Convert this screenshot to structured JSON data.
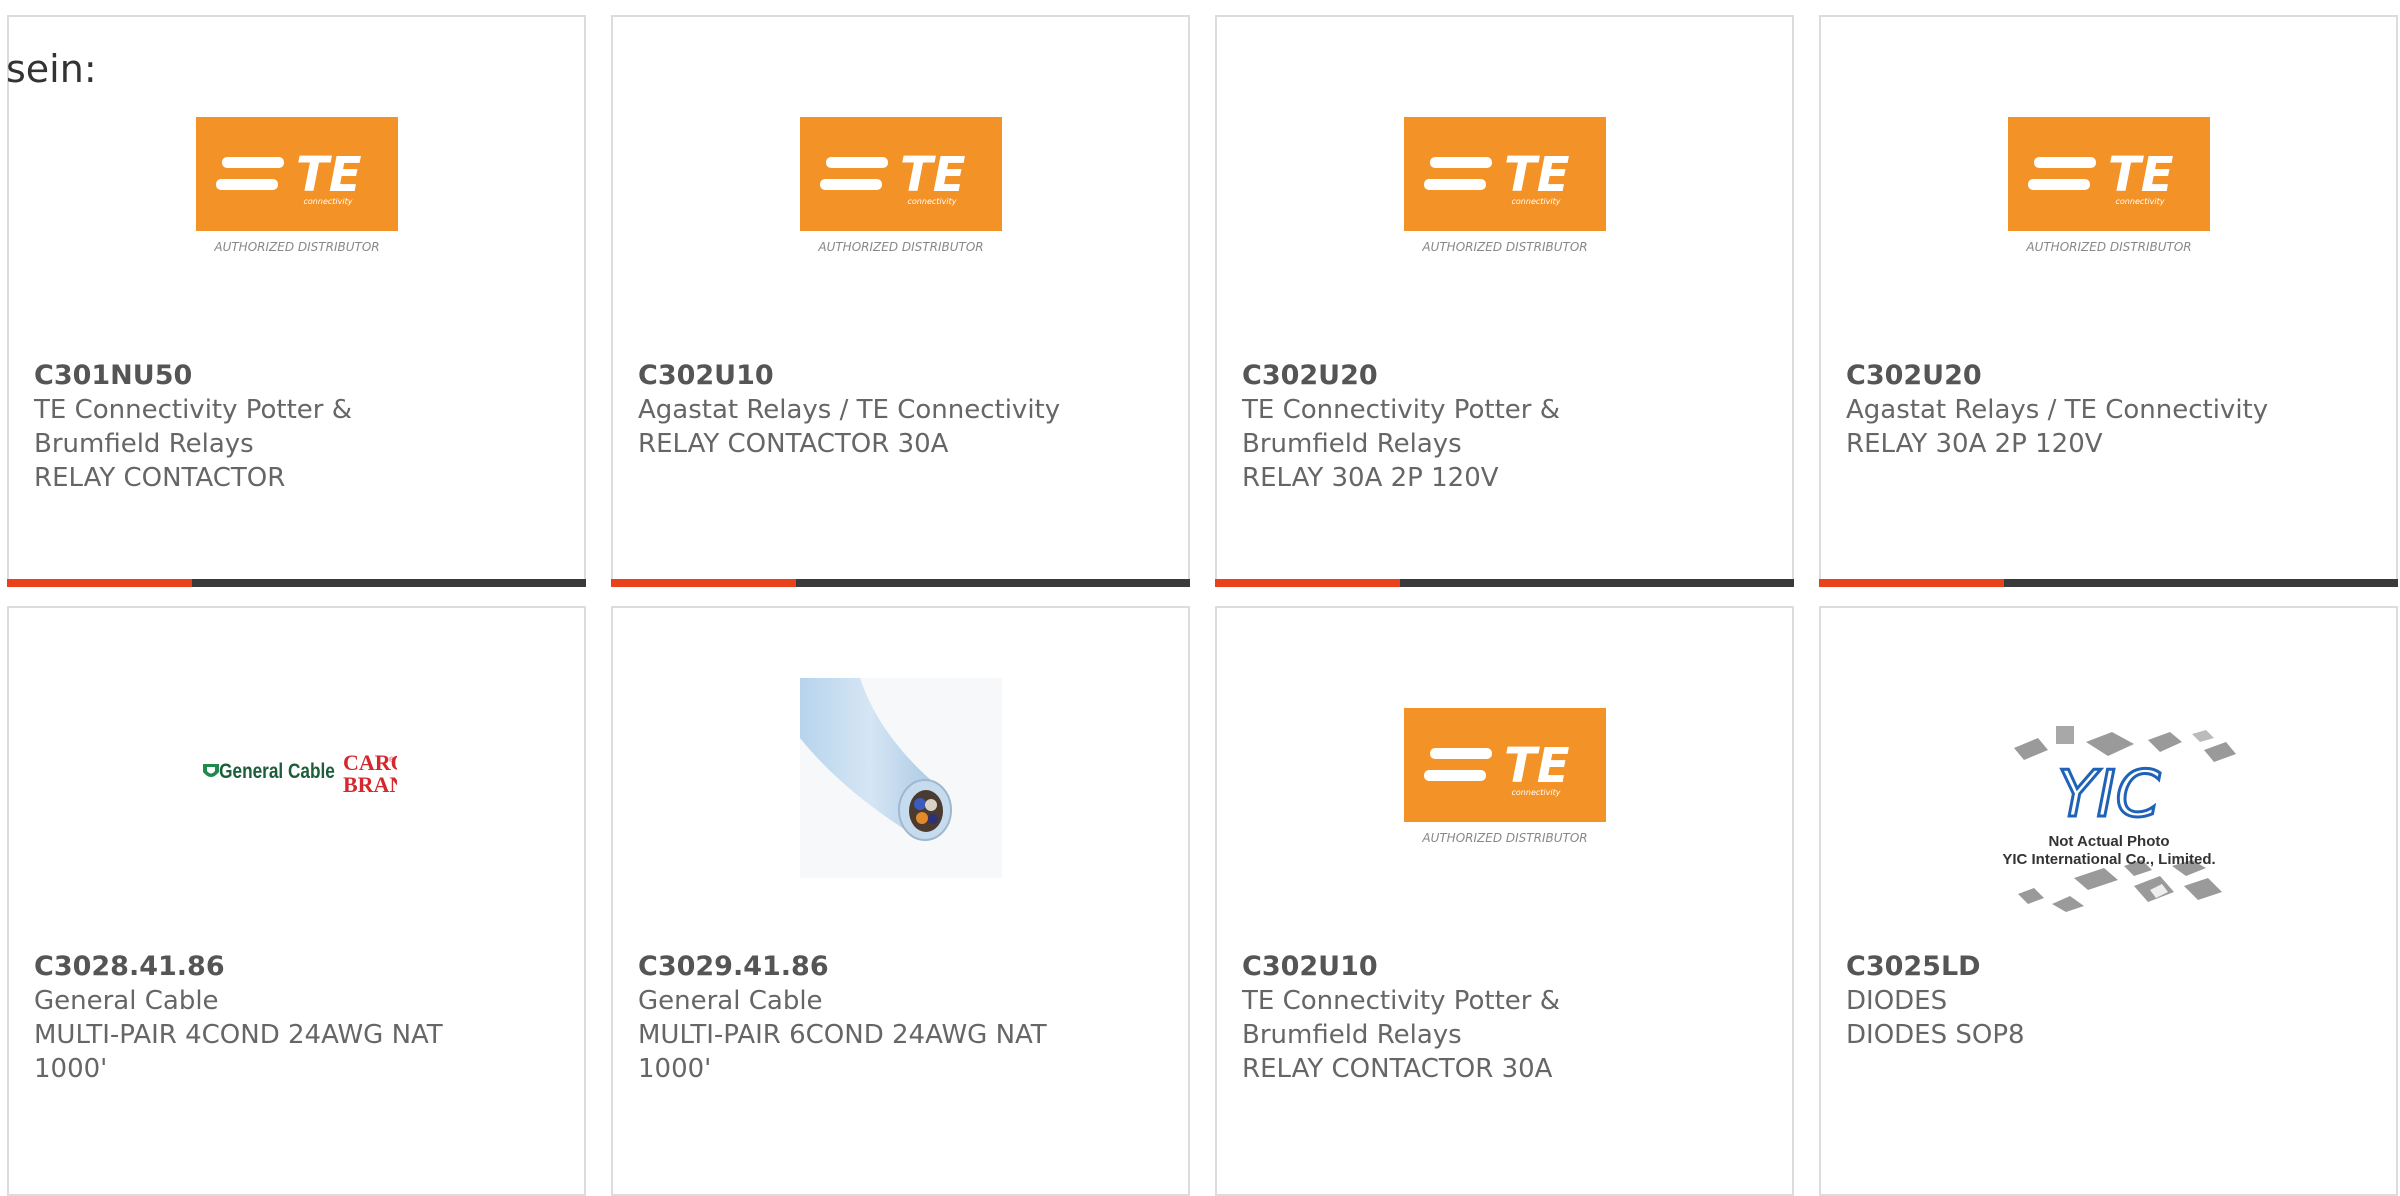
{
  "intro": "sein:",
  "colors": {
    "accent": "#e8411c",
    "bar_track": "#3a3a3a",
    "te_orange": "#f39226"
  },
  "te_logo": {
    "wordmark": "TE",
    "tagline": "connectivity",
    "caption": "AUTHORIZED DISTRIBUTOR"
  },
  "gc_logo": {
    "wordmark": "General Cable",
    "carol": "CAROL",
    "brand": "BRAND",
    "sup": "®"
  },
  "yic_logo": {
    "wordmark": "YIC",
    "line1": "Not Actual Photo",
    "line2": "YIC International Co., Limited."
  },
  "cards": [
    {
      "part": "C301NU50",
      "mfr1": "TE Connectivity Potter &",
      "mfr2": "Brumfield Relays",
      "desc1": "RELAY CONTACTOR",
      "desc2": "",
      "image": "te-logo",
      "progress": 0.32
    },
    {
      "part": "C302U10",
      "mfr1": "Agastat Relays / TE Connectivity",
      "mfr2": "",
      "desc1": "RELAY CONTACTOR 30A",
      "desc2": "",
      "image": "te-logo",
      "progress": 0.32
    },
    {
      "part": "C302U20",
      "mfr1": "TE Connectivity Potter &",
      "mfr2": "Brumfield Relays",
      "desc1": "RELAY 30A 2P 120V",
      "desc2": "",
      "image": "te-logo",
      "progress": 0.32
    },
    {
      "part": "C302U20",
      "mfr1": "Agastat Relays / TE Connectivity",
      "mfr2": "",
      "desc1": "RELAY 30A 2P 120V",
      "desc2": "",
      "image": "te-logo",
      "progress": 0.32
    },
    {
      "part": "C3028.41.86",
      "mfr1": "General Cable",
      "mfr2": "",
      "desc1": "MULTI-PAIR 4COND 24AWG NAT",
      "desc2": "1000'",
      "image": "general-cable-logo"
    },
    {
      "part": "C3029.41.86",
      "mfr1": "General Cable",
      "mfr2": "",
      "desc1": "MULTI-PAIR 6COND 24AWG NAT",
      "desc2": "1000'",
      "image": "cable-photo"
    },
    {
      "part": "C302U10",
      "mfr1": "TE Connectivity Potter &",
      "mfr2": "Brumfield Relays",
      "desc1": "RELAY CONTACTOR 30A",
      "desc2": "",
      "image": "te-logo"
    },
    {
      "part": "C3025LD",
      "mfr1": "DIODES",
      "mfr2": "",
      "desc1": "DIODES SOP8",
      "desc2": "",
      "image": "yic-placeholder"
    }
  ]
}
